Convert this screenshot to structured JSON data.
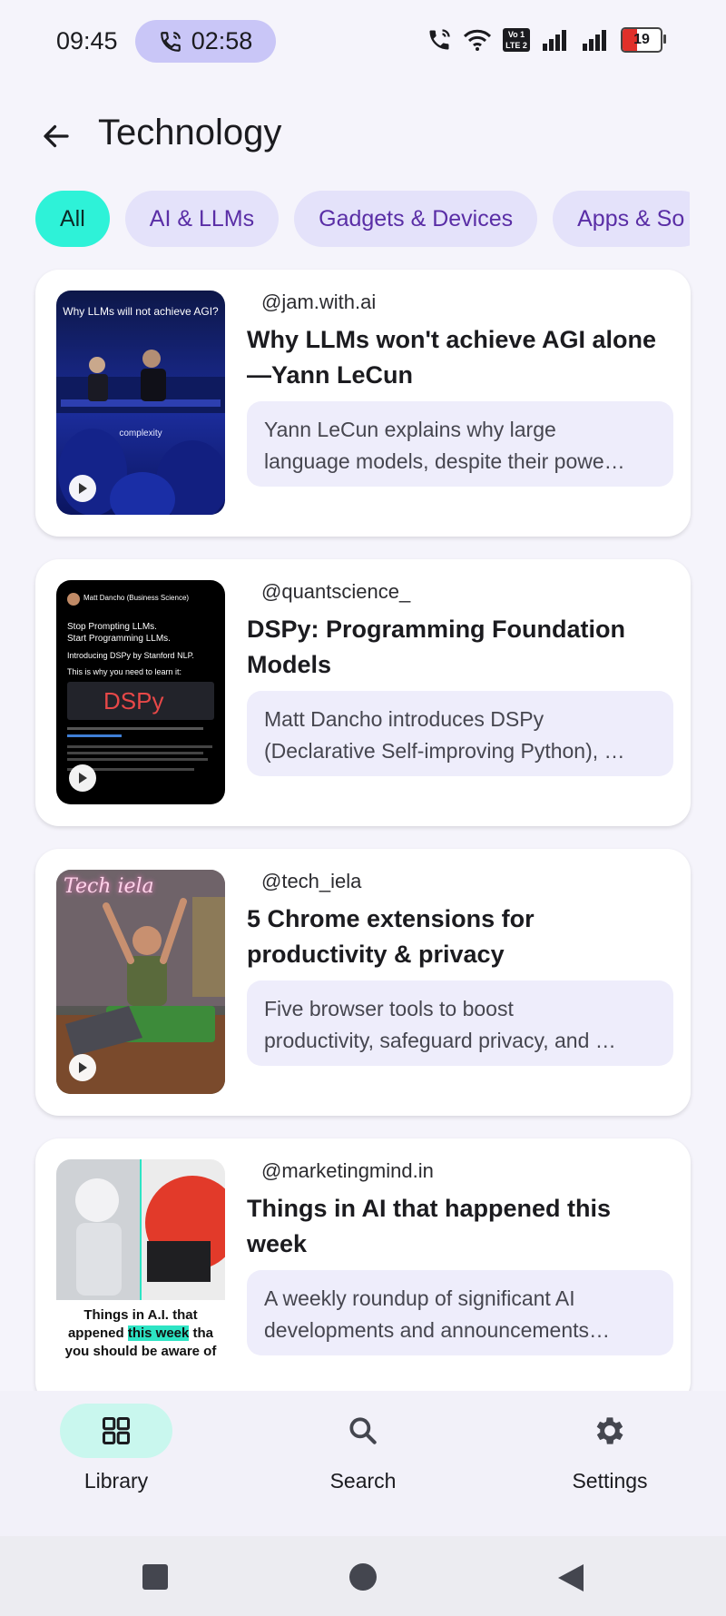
{
  "status_bar": {
    "time": "09:45",
    "call_timer": "02:58",
    "battery_level": "19",
    "icons": [
      "phone-call-icon",
      "wifi-icon",
      "volte-icon",
      "signal-icon",
      "signal-icon",
      "battery-icon"
    ],
    "lte_badge": {
      "line1": "Vo 1",
      "line2": "LTE 2"
    }
  },
  "header": {
    "back_icon": "arrow-left-icon",
    "title": "Technology"
  },
  "filter_chips": [
    {
      "label": "All",
      "selected": true
    },
    {
      "label": "AI & LLMs",
      "selected": false
    },
    {
      "label": "Gadgets & Devices",
      "selected": false
    },
    {
      "label": "Apps & So",
      "selected": false
    }
  ],
  "cards": [
    {
      "author": "@jam.with.ai",
      "title": "Why LLMs won't achieve AGI alone—Yann LeCun",
      "summary_line1": "Yann LeCun explains why large",
      "summary_line2": "language models, despite their powe…",
      "thumb": {
        "caption": "Why LLMs will not achieve AGI?",
        "sub": "complexity"
      }
    },
    {
      "author": "@quantscience_",
      "title": "DSPy: Programming Foundation Models",
      "summary_line1": "Matt Dancho introduces DSPy",
      "summary_line2": "(Declarative Self-improving Python), …",
      "thumb": {
        "header": "Matt Dancho (Business Science)",
        "line1": "Stop Prompting LLMs.",
        "line2": "Start Programming LLMs.",
        "line3": "Introducing DSPy by Stanford NLP.",
        "line4": "This is why you need to learn it:",
        "logo": "DSPy"
      }
    },
    {
      "author": "@tech_iela",
      "title": "5 Chrome extensions for productivity & privacy",
      "summary_line1": "Five browser tools to boost",
      "summary_line2": "productivity, safeguard privacy, and …",
      "thumb": {
        "neon": "Tech iela"
      }
    },
    {
      "author": "@marketingmind.in",
      "title": "Things in AI that happened this week",
      "summary_line1": "A weekly roundup of significant AI",
      "summary_line2": "developments and announcements…",
      "thumb": {
        "line1": "Things in A.I. that",
        "line2a": "appened ",
        "line2b": "this week",
        "line2c": " tha",
        "line3": "you should be aware of"
      }
    }
  ],
  "bottom_nav": [
    {
      "label": "Library",
      "icon": "grid-icon",
      "active": true
    },
    {
      "label": "Search",
      "icon": "search-icon",
      "active": false
    },
    {
      "label": "Settings",
      "icon": "gear-icon",
      "active": false
    }
  ],
  "colors": {
    "background": "#f5f4fb",
    "chip_active": "#2ef2d8",
    "chip_inactive": "#e4e2fa",
    "chip_text": "#5a2ea6",
    "nav_active": "#c9f7ee",
    "call_pill": "#c9c6f7"
  }
}
